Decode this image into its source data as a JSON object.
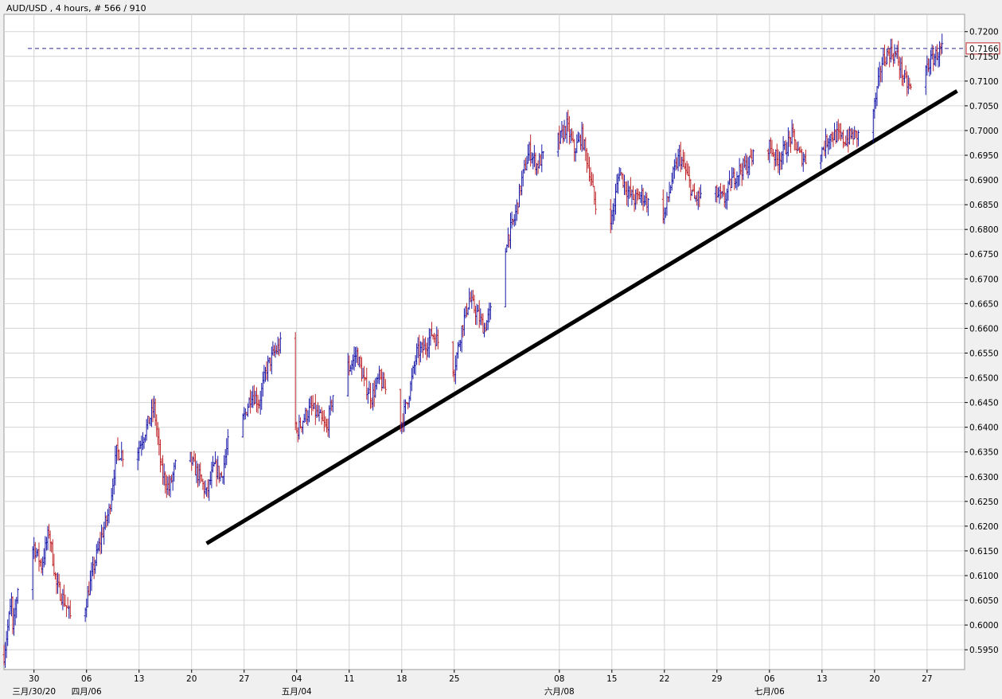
{
  "header": {
    "title": "AUD/USD , 4 hours, # 566 / 910"
  },
  "colors": {
    "up": "#1a1aaa",
    "down": "#c0262b",
    "grid": "#d3d3d3",
    "price_line": "#2a2a90",
    "price_box": "#c0262b",
    "trendline": "#000000"
  },
  "chart_data": {
    "type": "candlestick",
    "symbol": "AUD/USD",
    "timeframe": "4 hours",
    "ylim": [
      0.591,
      0.7235
    ],
    "y_ticks": [
      "0.7200",
      "0.7150",
      "0.7100",
      "0.7050",
      "0.7000",
      "0.6950",
      "0.6900",
      "0.6850",
      "0.6800",
      "0.6750",
      "0.6700",
      "0.6650",
      "0.6600",
      "0.6550",
      "0.6500",
      "0.6450",
      "0.6400",
      "0.6350",
      "0.6300",
      "0.6250",
      "0.6200",
      "0.6150",
      "0.6100",
      "0.6050",
      "0.6000",
      "0.5950"
    ],
    "x_range": [
      "2020-03-26",
      "2020-08-01"
    ],
    "x_ticks": [
      {
        "date": "2020-03-30",
        "label": "30"
      },
      {
        "date": "2020-04-06",
        "label": "06"
      },
      {
        "date": "2020-04-13",
        "label": "13"
      },
      {
        "date": "2020-04-20",
        "label": "20"
      },
      {
        "date": "2020-04-27",
        "label": "27"
      },
      {
        "date": "2020-05-04",
        "label": "04"
      },
      {
        "date": "2020-05-11",
        "label": "11"
      },
      {
        "date": "2020-05-18",
        "label": "18"
      },
      {
        "date": "2020-05-25",
        "label": "25"
      },
      {
        "date": "2020-06-08",
        "label": "08"
      },
      {
        "date": "2020-06-15",
        "label": "15"
      },
      {
        "date": "2020-06-22",
        "label": "22"
      },
      {
        "date": "2020-06-29",
        "label": "29"
      },
      {
        "date": "2020-07-06",
        "label": "06"
      },
      {
        "date": "2020-07-13",
        "label": "13"
      },
      {
        "date": "2020-07-20",
        "label": "20"
      },
      {
        "date": "2020-07-27",
        "label": "27"
      }
    ],
    "month_labels": [
      {
        "date": "2020-03-30",
        "label": "三月/30/20"
      },
      {
        "date": "2020-04-06",
        "label": "四月/06"
      },
      {
        "date": "2020-05-04",
        "label": "五月/04"
      },
      {
        "date": "2020-06-08",
        "label": "六月/08"
      },
      {
        "date": "2020-07-06",
        "label": "七月/06"
      }
    ],
    "current_price": "0.7166",
    "trendline": [
      {
        "date": "2020-04-22",
        "value": 0.6165
      },
      {
        "date": "2020-07-31",
        "value": 0.708
      }
    ],
    "close_path": [
      [
        "2020-03-26",
        0.594
      ],
      [
        "2020-03-27",
        0.605
      ],
      [
        "2020-03-27",
        0.596
      ],
      [
        "2020-03-28",
        0.61
      ],
      [
        "2020-03-30",
        0.616
      ],
      [
        "2020-03-31",
        0.612
      ],
      [
        "2020-04-01",
        0.619
      ],
      [
        "2020-04-02",
        0.608
      ],
      [
        "2020-04-03",
        0.605
      ],
      [
        "2020-04-04",
        0.601
      ],
      [
        "2020-04-05",
        0.5985
      ],
      [
        "2020-04-06",
        0.605
      ],
      [
        "2020-04-07",
        0.612
      ],
      [
        "2020-04-08",
        0.618
      ],
      [
        "2020-04-09",
        0.623
      ],
      [
        "2020-04-10",
        0.635
      ],
      [
        "2020-04-11",
        0.6345
      ],
      [
        "2020-04-12",
        0.634
      ],
      [
        "2020-04-13",
        0.636
      ],
      [
        "2020-04-14",
        0.64
      ],
      [
        "2020-04-15",
        0.644
      ],
      [
        "2020-04-16",
        0.631
      ],
      [
        "2020-04-17",
        0.6275
      ],
      [
        "2020-04-18",
        0.633
      ],
      [
        "2020-04-19",
        0.637
      ],
      [
        "2020-04-20",
        0.633
      ],
      [
        "2020-04-21",
        0.63
      ],
      [
        "2020-04-22",
        0.6265
      ],
      [
        "2020-04-23",
        0.632
      ],
      [
        "2020-04-24",
        0.63
      ],
      [
        "2020-04-25",
        0.638
      ],
      [
        "2020-04-26",
        0.639
      ],
      [
        "2020-04-27",
        0.642
      ],
      [
        "2020-04-28",
        0.647
      ],
      [
        "2020-04-29",
        0.645
      ],
      [
        "2020-04-30",
        0.652
      ],
      [
        "2020-05-01",
        0.655
      ],
      [
        "2020-05-02",
        0.657
      ],
      [
        "2020-05-03",
        0.648
      ],
      [
        "2020-05-04",
        0.639
      ],
      [
        "2020-05-05",
        0.642
      ],
      [
        "2020-05-06",
        0.644
      ],
      [
        "2020-05-07",
        0.642
      ],
      [
        "2020-05-08",
        0.6395
      ],
      [
        "2020-05-09",
        0.648
      ],
      [
        "2020-05-10",
        0.654
      ],
      [
        "2020-05-11",
        0.652
      ],
      [
        "2020-05-12",
        0.655
      ],
      [
        "2020-05-13",
        0.649
      ],
      [
        "2020-05-14",
        0.646
      ],
      [
        "2020-05-15",
        0.65
      ],
      [
        "2020-05-16",
        0.647
      ],
      [
        "2020-05-17",
        0.643
      ],
      [
        "2020-05-18",
        0.641
      ],
      [
        "2020-05-19",
        0.647
      ],
      [
        "2020-05-20",
        0.655
      ],
      [
        "2020-05-21",
        0.656
      ],
      [
        "2020-05-22",
        0.659
      ],
      [
        "2020-05-23",
        0.657
      ],
      [
        "2020-05-24",
        0.653
      ],
      [
        "2020-05-25",
        0.652
      ],
      [
        "2020-05-26",
        0.66
      ],
      [
        "2020-05-27",
        0.666
      ],
      [
        "2020-05-28",
        0.663
      ],
      [
        "2020-05-29",
        0.66
      ],
      [
        "2020-05-30",
        0.664
      ],
      [
        "2020-05-31",
        0.665
      ],
      [
        "2020-06-01",
        0.678
      ],
      [
        "2020-06-02",
        0.682
      ],
      [
        "2020-06-03",
        0.69
      ],
      [
        "2020-06-04",
        0.696
      ],
      [
        "2020-06-05",
        0.693
      ],
      [
        "2020-06-06",
        0.695
      ],
      [
        "2020-06-07",
        0.699
      ],
      [
        "2020-06-08",
        0.698
      ],
      [
        "2020-06-09",
        0.701
      ],
      [
        "2020-06-10",
        0.696
      ],
      [
        "2020-06-11",
        0.699
      ],
      [
        "2020-06-12",
        0.692
      ],
      [
        "2020-06-13",
        0.683
      ],
      [
        "2020-06-14",
        0.686
      ],
      [
        "2020-06-15",
        0.682
      ],
      [
        "2020-06-16",
        0.692
      ],
      [
        "2020-06-17",
        0.688
      ],
      [
        "2020-06-18",
        0.686
      ],
      [
        "2020-06-19",
        0.687
      ],
      [
        "2020-06-20",
        0.685
      ],
      [
        "2020-06-21",
        0.684
      ],
      [
        "2020-06-22",
        0.683
      ],
      [
        "2020-06-23",
        0.69
      ],
      [
        "2020-06-24",
        0.695
      ],
      [
        "2020-06-25",
        0.691
      ],
      [
        "2020-06-26",
        0.686
      ],
      [
        "2020-06-27",
        0.687
      ],
      [
        "2020-06-28",
        0.688
      ],
      [
        "2020-06-29",
        0.687
      ],
      [
        "2020-06-30",
        0.686
      ],
      [
        "2020-07-01",
        0.69
      ],
      [
        "2020-07-02",
        0.692
      ],
      [
        "2020-07-03",
        0.693
      ],
      [
        "2020-07-04",
        0.695
      ],
      [
        "2020-07-05",
        0.696
      ],
      [
        "2020-07-06",
        0.697
      ],
      [
        "2020-07-07",
        0.694
      ],
      [
        "2020-07-08",
        0.696
      ],
      [
        "2020-07-09",
        0.699
      ],
      [
        "2020-07-10",
        0.695
      ],
      [
        "2020-07-11",
        0.694
      ],
      [
        "2020-07-12",
        0.697
      ],
      [
        "2020-07-13",
        0.696
      ],
      [
        "2020-07-14",
        0.699
      ],
      [
        "2020-07-15",
        0.699
      ],
      [
        "2020-07-16",
        0.698
      ],
      [
        "2020-07-17",
        0.699
      ],
      [
        "2020-07-18",
        0.699
      ],
      [
        "2020-07-19",
        0.7
      ],
      [
        "2020-07-20",
        0.705
      ],
      [
        "2020-07-21",
        0.714
      ],
      [
        "2020-07-22",
        0.716
      ],
      [
        "2020-07-23",
        0.715
      ],
      [
        "2020-07-24",
        0.71
      ],
      [
        "2020-07-25",
        0.708
      ],
      [
        "2020-07-26",
        0.709
      ],
      [
        "2020-07-27",
        0.713
      ],
      [
        "2020-07-28",
        0.715
      ],
      [
        "2020-07-29",
        0.7165
      ]
    ]
  }
}
